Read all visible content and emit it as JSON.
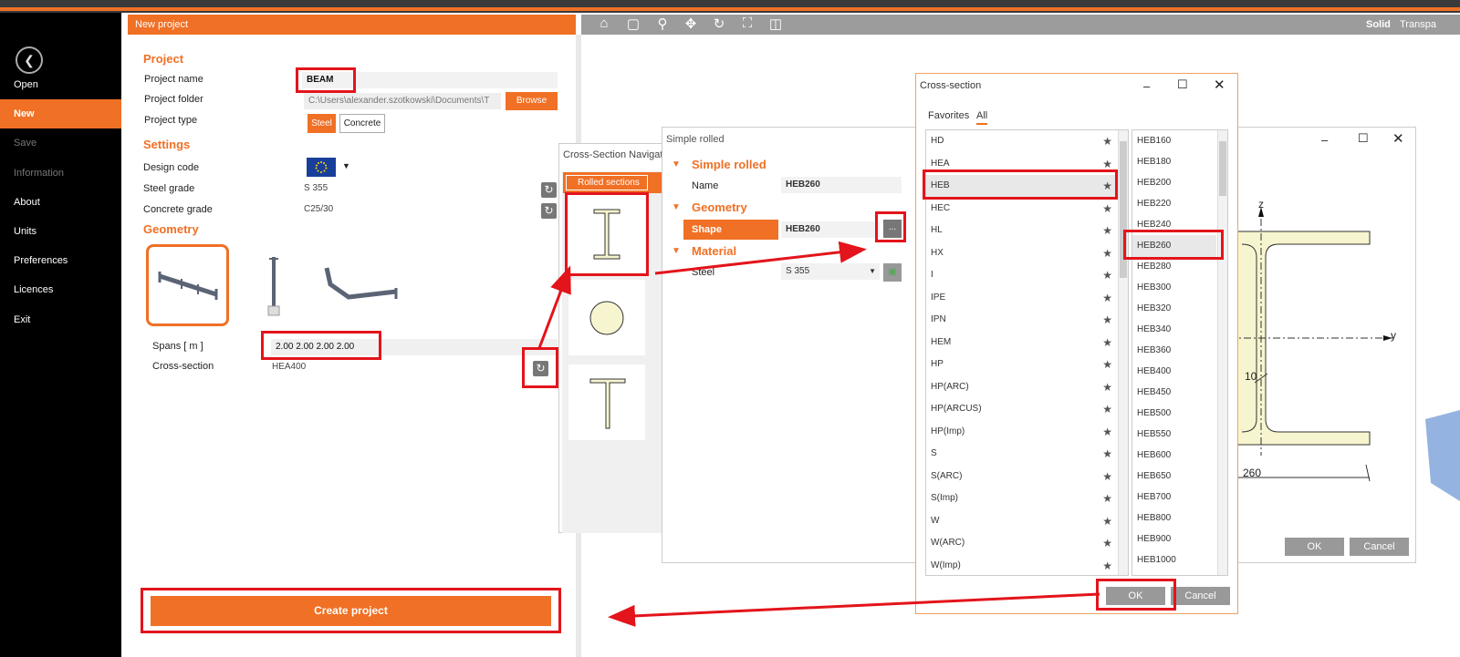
{
  "sidebar": {
    "items": [
      {
        "label": "Open",
        "state": "normal"
      },
      {
        "label": "New",
        "state": "active"
      },
      {
        "label": "Save",
        "state": "disabled"
      },
      {
        "label": "Information",
        "state": "disabled"
      },
      {
        "label": "About",
        "state": "normal"
      },
      {
        "label": "Units",
        "state": "normal"
      },
      {
        "label": "Preferences",
        "state": "normal"
      },
      {
        "label": "Licences",
        "state": "normal"
      },
      {
        "label": "Exit",
        "state": "normal"
      }
    ]
  },
  "left_panel": {
    "header": "New project",
    "project_title": "Project",
    "project_name_label": "Project name",
    "project_name_value": "BEAM",
    "project_folder_label": "Project folder",
    "project_folder_value": "C:\\Users\\alexander.szotkowski\\Documents\\T",
    "browse_label": "Browse",
    "project_type_label": "Project type",
    "type_steel": "Steel",
    "type_concrete": "Concrete",
    "settings_title": "Settings",
    "design_code_label": "Design code",
    "steel_grade_label": "Steel grade",
    "steel_grade_value": "S 355",
    "concrete_grade_label": "Concrete grade",
    "concrete_grade_value": "C25/30",
    "geometry_title": "Geometry",
    "spans_label": "Spans  [ m ]",
    "spans_value": "2.00 2.00 2.00 2.00",
    "cross_section_label": "Cross-section",
    "cross_section_value": "HEA400",
    "create_label": "Create project"
  },
  "view_toolbar": {
    "icons": [
      "home-icon",
      "zoom-window-icon",
      "zoom-icon",
      "move-icon",
      "rotate-icon",
      "fit-icon",
      "view-icon"
    ],
    "solid": "Solid",
    "transparent": "Transpa"
  },
  "navigator": {
    "title": "Cross-Section Navigator",
    "tab_rolled": "Rolled sections"
  },
  "simple_rolled": {
    "title": "Simple rolled",
    "sec_simple": "Simple rolled",
    "name_label": "Name",
    "name_value": "HEB260",
    "sec_geometry": "Geometry",
    "shape_label": "Shape",
    "shape_value": "HEB260",
    "shape_btn": "...",
    "sec_material": "Material",
    "steel_label": "Steel",
    "steel_value": "S 355"
  },
  "cs_dialog": {
    "title": "Cross-section",
    "tab_favorites": "Favorites",
    "tab_all": "All",
    "families": [
      "HD",
      "HEA",
      "HEB",
      "HEC",
      "HL",
      "HX",
      "I",
      "IPE",
      "IPN",
      "HEM",
      "HP",
      "HP(ARC)",
      "HP(ARCUS)",
      "HP(Imp)",
      "S",
      "S(ARC)",
      "S(Imp)",
      "W",
      "W(ARC)",
      "W(Imp)"
    ],
    "selected_family": "HEB",
    "sizes": [
      "HEB160",
      "HEB180",
      "HEB200",
      "HEB220",
      "HEB240",
      "HEB260",
      "HEB280",
      "HEB300",
      "HEB320",
      "HEB340",
      "HEB360",
      "HEB400",
      "HEB450",
      "HEB500",
      "HEB550",
      "HEB600",
      "HEB650",
      "HEB700",
      "HEB800",
      "HEB900",
      "HEB1000"
    ],
    "selected_size": "HEB260",
    "ok": "OK",
    "cancel": "Cancel"
  },
  "right_window": {
    "axis_z": "z",
    "axis_y": "y",
    "dim_web": "10",
    "dim_width": "260",
    "ok": "OK",
    "cancel": "Cancel"
  },
  "colors": {
    "accent": "#f07025",
    "highlight": "#e3141b",
    "section_fill": "#f7f5cf"
  }
}
